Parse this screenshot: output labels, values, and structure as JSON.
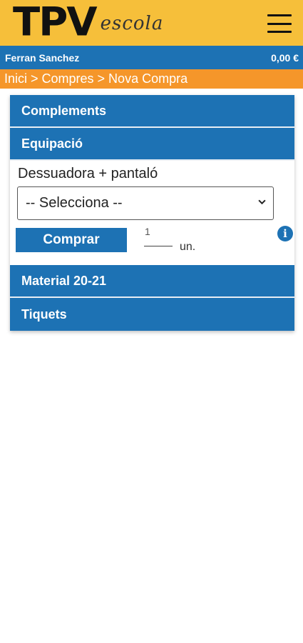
{
  "header": {
    "logo_main": "TPV",
    "logo_script": "escola",
    "menu_icon": "hamburger-menu-icon"
  },
  "user": {
    "name": "Ferran Sanchez",
    "balance": "0,00 €"
  },
  "breadcrumb": {
    "text": "Inici > Compres > Nova Compra"
  },
  "sections": {
    "complements": "Complements",
    "equipacio": "Equipació",
    "material": "Material 20-21",
    "tiquets": "Tiquets"
  },
  "product": {
    "name": "Dessuadora + pantaló",
    "select_value": "-- Selecciona --",
    "buy_label": "Comprar",
    "quantity": "1",
    "unit": "un.",
    "info_icon": "info-icon"
  },
  "colors": {
    "header_yellow": "#f6bf3a",
    "primary_blue": "#1d72b4",
    "breadcrumb_orange": "#f5962a"
  }
}
